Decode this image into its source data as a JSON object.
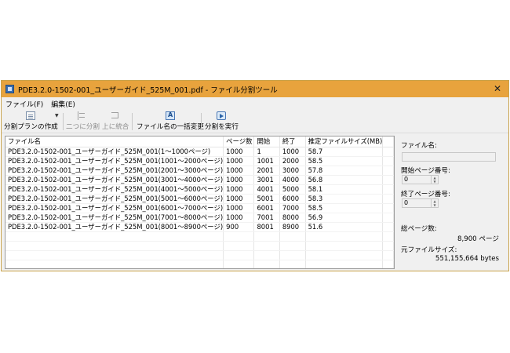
{
  "window": {
    "title": "PDE3.2.0-1502-001_ユーザーガイド_525M_001.pdf - ファイル分割ツール",
    "close_glyph": "✕"
  },
  "menu": [
    {
      "label": "ファイル(F)"
    },
    {
      "label": "編集(E)"
    }
  ],
  "toolbar": {
    "create_plan": "分割プランの作成",
    "split_two": "二つに分割",
    "merge_up": "上に統合",
    "rename_all": "ファイル名の一括変更",
    "run_split": "分割を実行"
  },
  "grid": {
    "columns": [
      "ファイル名",
      "ページ数",
      "開始",
      "終了",
      "推定ファイルサイズ(MB)"
    ],
    "rows": [
      [
        "PDE3.2.0-1502-001_ユーザーガイド_525M_001(1～1000ページ)",
        "1000",
        "1",
        "1000",
        "58.7"
      ],
      [
        "PDE3.2.0-1502-001_ユーザーガイド_525M_001(1001～2000ページ)",
        "1000",
        "1001",
        "2000",
        "58.5"
      ],
      [
        "PDE3.2.0-1502-001_ユーザーガイド_525M_001(2001～3000ページ)",
        "1000",
        "2001",
        "3000",
        "57.8"
      ],
      [
        "PDE3.2.0-1502-001_ユーザーガイド_525M_001(3001～4000ページ)",
        "1000",
        "3001",
        "4000",
        "56.8"
      ],
      [
        "PDE3.2.0-1502-001_ユーザーガイド_525M_001(4001～5000ページ)",
        "1000",
        "4001",
        "5000",
        "58.1"
      ],
      [
        "PDE3.2.0-1502-001_ユーザーガイド_525M_001(5001～6000ページ)",
        "1000",
        "5001",
        "6000",
        "58.3"
      ],
      [
        "PDE3.2.0-1502-001_ユーザーガイド_525M_001(6001～7000ページ)",
        "1000",
        "6001",
        "7000",
        "58.5"
      ],
      [
        "PDE3.2.0-1502-001_ユーザーガイド_525M_001(7001～8000ページ)",
        "1000",
        "7001",
        "8000",
        "56.9"
      ],
      [
        "PDE3.2.0-1502-001_ユーザーガイド_525M_001(8001～8900ページ)",
        "900",
        "8001",
        "8900",
        "51.6"
      ]
    ],
    "empty_rows": 5
  },
  "side": {
    "filename_label": "ファイル名:",
    "filename_value": "",
    "start_page_label": "開始ページ番号:",
    "start_page_value": "0",
    "end_page_label": "終了ページ番号:",
    "end_page_value": "0",
    "total_pages_label": "総ページ数:",
    "total_pages_value": "8,900 ページ",
    "original_size_label": "元ファイルサイズ:",
    "original_size_value": "551,155,664 bytes"
  }
}
